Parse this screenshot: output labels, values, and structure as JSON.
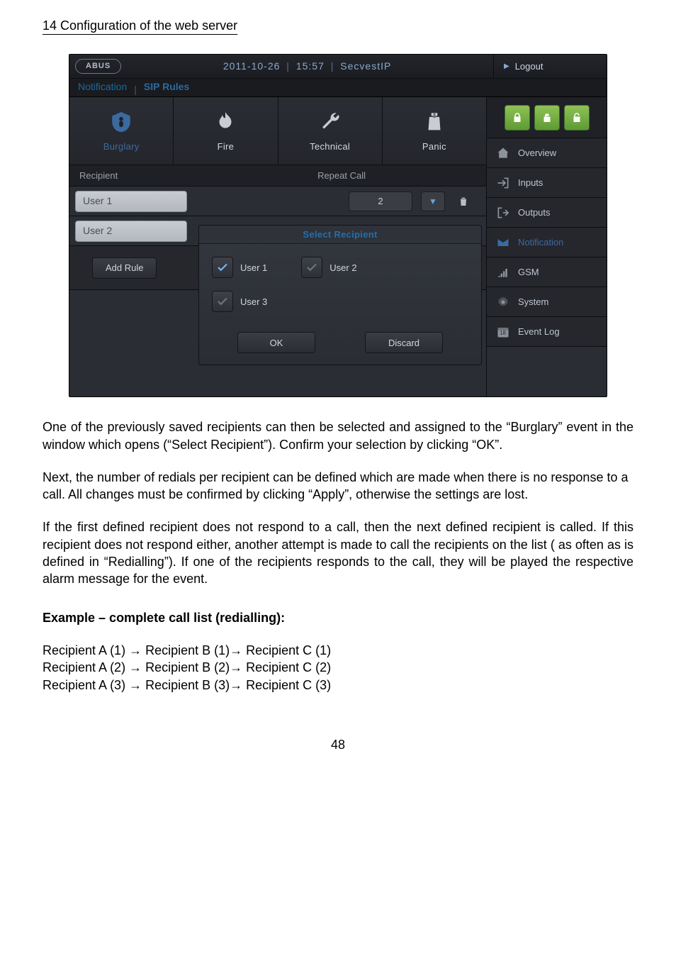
{
  "page": {
    "section_header": "14  Configuration of the web server",
    "footer_page": "48"
  },
  "header": {
    "brand": "ABUS",
    "date": "2011-10-26",
    "time": "15:57",
    "product": "SecvestIP",
    "logout_label": "Logout"
  },
  "breadcrumb": {
    "notification": "Notification",
    "sip_rules": "SIP Rules"
  },
  "events": {
    "burglary": "Burglary",
    "fire": "Fire",
    "technical": "Technical",
    "panic": "Panic"
  },
  "subheader": {
    "recipient": "Recipient",
    "repeat_call": "Repeat Call"
  },
  "rows": {
    "user1": "User 1",
    "user1_repeat": "2",
    "user2": "User 2"
  },
  "buttons": {
    "add_rule": "Add Rule",
    "ok": "OK",
    "discard": "Discard"
  },
  "modal": {
    "title": "Select Recipient",
    "opt_user1": "User 1",
    "opt_user2": "User 2",
    "opt_user3": "User 3"
  },
  "sidebar": {
    "overview": "Overview",
    "inputs": "Inputs",
    "outputs": "Outputs",
    "notification": "Notification",
    "gsm": "GSM",
    "system": "System",
    "event_log": "Event Log",
    "calendar_day": "18"
  },
  "article": {
    "p1": "One of the previously saved recipients can then be selected and assigned to the “Burglary” event in the window which opens (“Select Recipient”). Confirm your selection by clicking “OK”.",
    "p2": "Next, the number of redials per recipient can be defined which are made when there is no response to a call. All changes must be confirmed by clicking “Apply”, otherwise the settings are lost.",
    "p3": "If the first defined recipient does not respond to a call, then the next defined recipient is called. If this recipient does not respond either, another attempt is made to call the recipients on the list ( as often as is defined in “Redialling”). If one of the recipients responds to the call, they will be played the respective alarm message for the event.",
    "example_title": "Example – complete call list (redialling):",
    "ex1": "Recipient A (1) → Recipient B (1)→ Recipient C (1)",
    "ex2": "Recipient A (2) → Recipient B (2)→ Recipient C (2)",
    "ex3": "Recipient A (3) → Recipient B (3)→ Recipient C (3)"
  }
}
